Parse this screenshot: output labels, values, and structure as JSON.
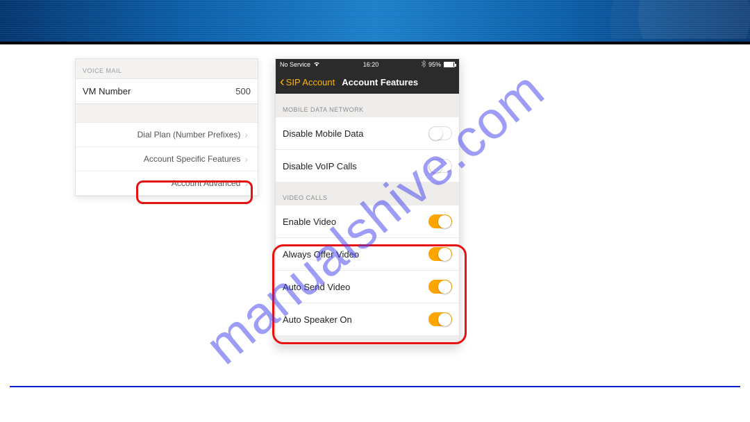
{
  "watermark_text": "manualshive.com",
  "left_panel": {
    "section_header": "VOICE MAIL",
    "vm_label": "VM Number",
    "vm_value": "500",
    "nav": {
      "dial_plan": "Dial Plan (Number Prefixes)",
      "account_specific": "Account Specific Features",
      "account_advanced": "Account Advanced"
    }
  },
  "phone": {
    "status": {
      "carrier": "No Service",
      "time": "16:20",
      "battery": "95%"
    },
    "nav": {
      "back_label": "SIP Account",
      "title": "Account Features"
    },
    "section1_header": "MOBILE DATA NETWORK",
    "section1": {
      "disable_mobile_data": "Disable Mobile Data",
      "disable_voip": "Disable VoIP Calls"
    },
    "section2_header": "VIDEO CALLS",
    "section2": {
      "enable_video": "Enable Video",
      "always_offer": "Always Offer Video",
      "auto_send": "Auto Send Video",
      "auto_speaker": "Auto Speaker On"
    },
    "toggles": {
      "disable_mobile_data": false,
      "disable_voip": false,
      "enable_video": true,
      "always_offer": true,
      "auto_send": true,
      "auto_speaker": true
    }
  }
}
